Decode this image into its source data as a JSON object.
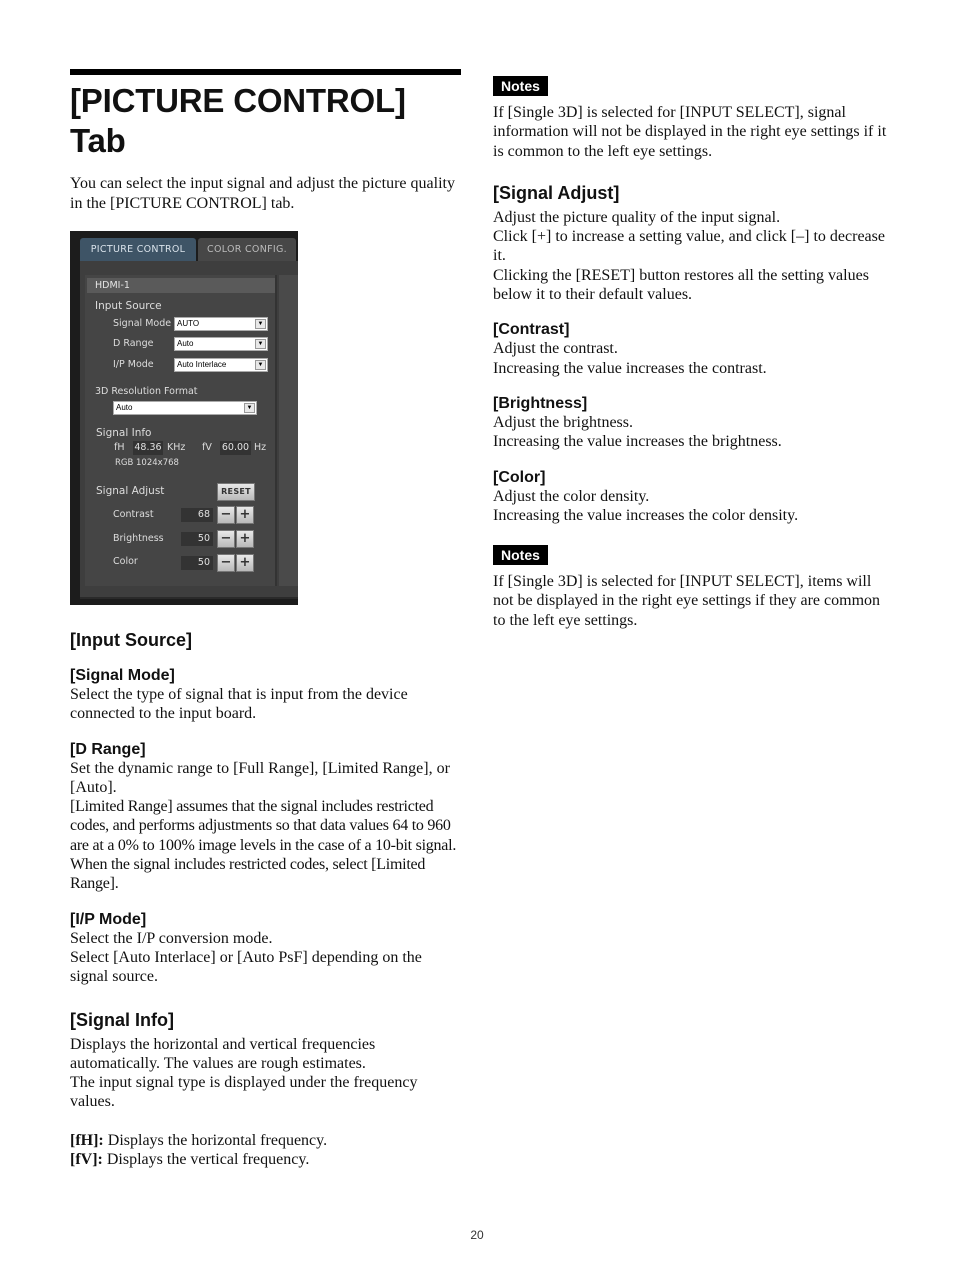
{
  "page": {
    "title": "[PICTURE CONTROL] Tab",
    "intro": "You can select the input signal and adjust the picture quality in the [PICTURE CONTROL] tab.",
    "page_number": "20"
  },
  "screenshot": {
    "tabs": [
      {
        "label": "PICTURE CONTROL",
        "active": true
      },
      {
        "label": "COLOR CONFIG.",
        "active": false
      }
    ],
    "input_name": "HDMI-1",
    "input_source": {
      "heading": "Input Source",
      "signal_mode": {
        "label": "Signal Mode",
        "value": "AUTO"
      },
      "d_range": {
        "label": "D Range",
        "value": "Auto"
      },
      "ip_mode": {
        "label": "I/P Mode",
        "value": "Auto Interlace"
      }
    },
    "resolution_format": {
      "label": "3D Resolution Format",
      "value": "Auto"
    },
    "signal_info": {
      "heading": "Signal Info",
      "fh_label": "fH",
      "fh_value": "48.36",
      "fh_unit": "KHz",
      "fv_label": "fV",
      "fv_value": "60.00",
      "fv_unit": "Hz",
      "signal_type": "RGB 1024x768"
    },
    "signal_adjust": {
      "heading": "Signal Adjust",
      "reset_label": "RESET",
      "minus_label": "−",
      "plus_label": "+",
      "rows": [
        {
          "label": "Contrast",
          "value": "68"
        },
        {
          "label": "Brightness",
          "value": "50"
        },
        {
          "label": "Color",
          "value": "50"
        }
      ]
    }
  },
  "left": {
    "input_source_heading": "[Input Source]",
    "signal_mode": {
      "heading": "[Signal Mode]",
      "text": "Select the type of signal that is input from the device connected to the input board."
    },
    "d_range": {
      "heading": "[D Range]",
      "text1": "Set the dynamic range to [Full Range], [Limited Range], or [Auto].",
      "text2": "[Limited Range] assumes that the signal includes restricted codes, and performs adjustments so that data values 64 to 960 are at a 0% to 100% image levels in the case of a 10-bit signal. When the signal includes restricted codes, select [Limited Range]."
    },
    "ip_mode": {
      "heading": "[I/P Mode]",
      "text1": "Select the I/P conversion mode.",
      "text2": "Select [Auto Interlace] or [Auto PsF] depending on the signal source."
    },
    "signal_info": {
      "heading": "[Signal Info]",
      "text1": "Displays the horizontal and vertical frequencies automatically. The values are rough estimates.",
      "text2": "The input signal type is displayed under the frequency values.",
      "fh_term": "[fH]:",
      "fh_text": " Displays the horizontal frequency.",
      "fv_term": "[fV]:",
      "fv_text": " Displays the vertical frequency."
    }
  },
  "right": {
    "notes1": {
      "badge": "Notes",
      "text": "If [Single 3D] is selected for [INPUT SELECT], signal information will not be displayed in the right eye settings if it is common to the left eye settings."
    },
    "signal_adjust": {
      "heading": "[Signal Adjust]",
      "text1": "Adjust the picture quality of the input signal.",
      "text2": "Click [+] to increase a setting value, and click [–] to decrease it.",
      "text3": "Clicking the [RESET] button restores all the setting values below it to their default values."
    },
    "contrast": {
      "heading": "[Contrast]",
      "text1": "Adjust the contrast.",
      "text2": "Increasing the value increases the contrast."
    },
    "brightness": {
      "heading": "[Brightness]",
      "text1": "Adjust the brightness.",
      "text2": "Increasing the value increases the brightness."
    },
    "color": {
      "heading": "[Color]",
      "text1": "Adjust the color density.",
      "text2": "Increasing the value increases the color density."
    },
    "notes2": {
      "badge": "Notes",
      "text": "If [Single 3D] is selected for [INPUT SELECT], items will not be displayed in the right eye settings if they are common to the left eye settings."
    }
  }
}
